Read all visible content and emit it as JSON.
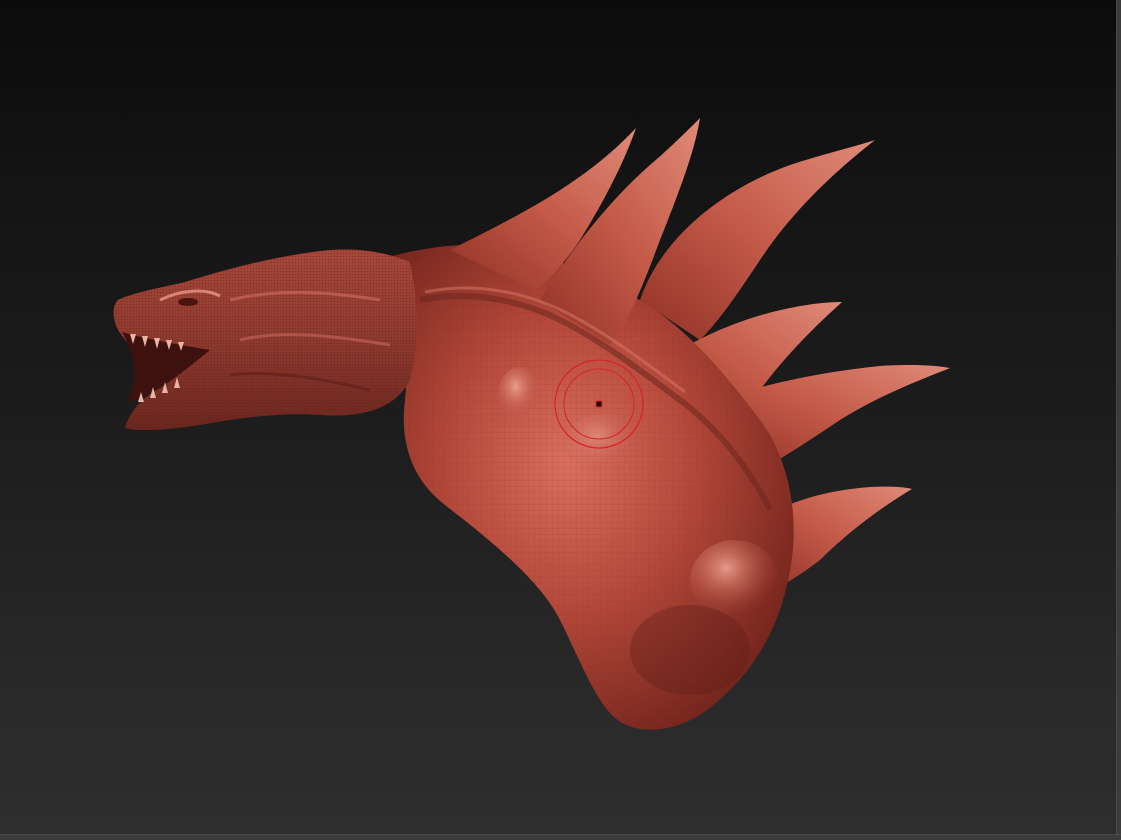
{
  "app": {
    "viewport_label": "",
    "background_top": "#0b0b0b",
    "background_bottom": "#2e2e2e"
  },
  "model": {
    "material_color": "#b5493b",
    "highlight_color": "#e6907f",
    "shadow_color": "#5c1c16",
    "icon": "dragon-sculpt"
  },
  "brush": {
    "icon": "brush-cursor-icon",
    "ring_color": "#d9242b"
  }
}
